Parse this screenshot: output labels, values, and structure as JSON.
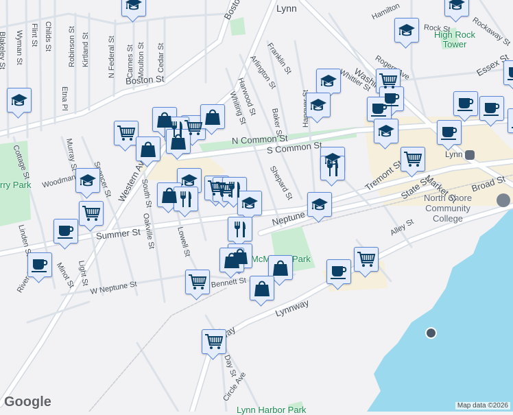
{
  "map": {
    "city_label": "Lynn",
    "places": {
      "high_rock": "High Rock Tower",
      "nscc": "North Shore Community College",
      "station": "Lynn",
      "mcmanus": "McManus Park",
      "lynn_harbor": "Lynn Harbor Park",
      "perry": "rry Park"
    },
    "streets": [
      "Blakeley St",
      "Wyman St",
      "Flint St",
      "Childs St",
      "Robinson St",
      "Kirtland St",
      "N Federal St",
      "Carnes St",
      "Moulton St",
      "Cedar St",
      "Boston St",
      "Etna Pl",
      "Whiting St",
      "Harwood St",
      "Arlington St",
      "Franklin St",
      "Baker St",
      "Hanover St",
      "N Common St",
      "S Common St",
      "Shepard St",
      "Cottage St",
      "Murray St",
      "Spencer St",
      "Western Ave",
      "South St",
      "Oakville St",
      "Summer St",
      "Lowell St",
      "Neptune Blvd",
      "Linden St",
      "Light St",
      "Minot St",
      "W Neptune St",
      "Bennett St",
      "Lynnway",
      "Day St",
      "Circle Ave",
      "Tremont St",
      "State St",
      "Market St",
      "Broad St",
      "Alley St",
      "Washington St",
      "Whittier St",
      "Rogers Ave",
      "Essex St",
      "Rockaway St",
      "Rock St",
      "Hamilton",
      "Woodman St",
      "Boston St",
      "River St",
      "Lynnway"
    ],
    "attribution": "Map data ©2026",
    "google_logo": "Google"
  },
  "colors": {
    "water": "#9ad9ee",
    "park": "#c9ecd3",
    "road": "#ffffff",
    "road_edge": "#d3dae2",
    "commercial": "#f6efdc",
    "marker_fill": "#e5ecfb",
    "marker_border": "#5b87d8",
    "icon": "#0b3f66"
  }
}
